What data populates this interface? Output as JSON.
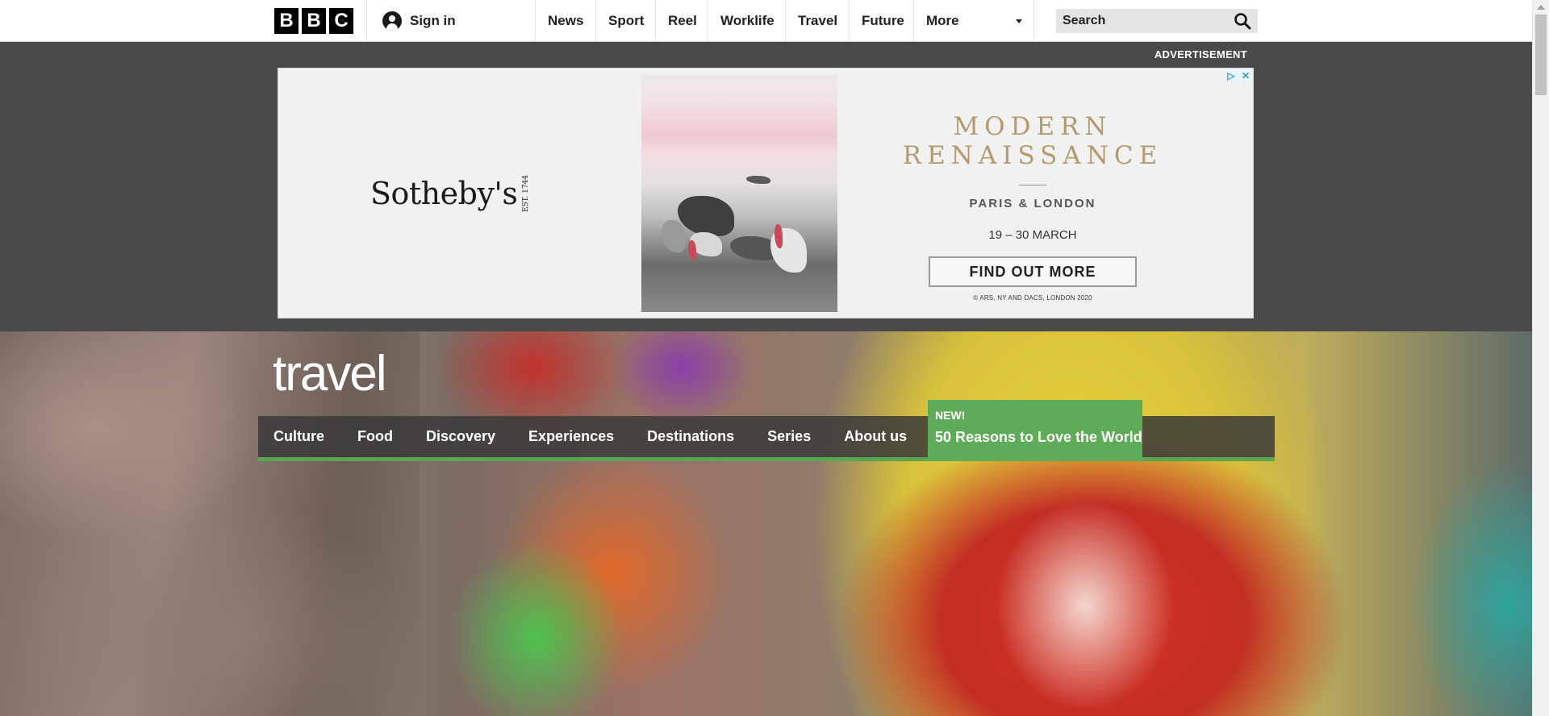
{
  "header": {
    "logo_letters": [
      "B",
      "B",
      "C"
    ],
    "signin_label": "Sign in",
    "nav": [
      "News",
      "Sport",
      "Reel",
      "Worklife",
      "Travel",
      "Future"
    ],
    "more_label": "More",
    "search_label": "Search"
  },
  "advert": {
    "label": "ADVERTISEMENT",
    "brand": "Sotheby's",
    "brand_est": "EST. 1744",
    "headline_line1": "MODERN",
    "headline_line2": "RENAISSANCE",
    "locations": "PARIS & LONDON",
    "dates": "19 – 30 MARCH",
    "cta": "FIND OUT MORE",
    "copyright": "© ARS, NY AND DACS, LONDON 2020"
  },
  "travel": {
    "logo": "travel",
    "nav": [
      "Culture",
      "Food",
      "Discovery",
      "Experiences",
      "Destinations",
      "Series",
      "About us"
    ],
    "promo": {
      "badge": "NEW!",
      "title": "50 Reasons to Love the World"
    }
  },
  "colors": {
    "travel_green": "#5eab58",
    "ad_band": "#4a4a4a",
    "ad_gold": "#b49a6e"
  }
}
